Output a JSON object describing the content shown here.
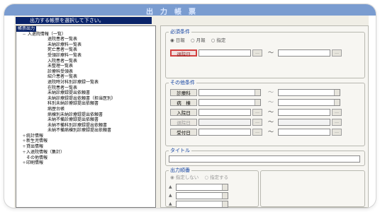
{
  "window": {
    "title": "出力帳票",
    "instruction": "出力する帳票を選択して下さい。"
  },
  "tree": {
    "root_label": "帳票出力",
    "group_main": "入退院情報（一覧）",
    "children": [
      "退院患者一覧表",
      "未納診療料一覧表",
      "死亡患者一覧表",
      "受領診療料一覧表",
      "入院患者一覧表",
      "未整理一覧表",
      "診療科受領表",
      "紹介患者一覧表",
      "退院時対科別診療録一覧表",
      "在院患者一覧表",
      "未納診療録提出依頼書",
      "未納診療録提出依頼書（担当医別）",
      "科別未納診療録提出依頼書",
      "病歴台帳",
      "病棟別未納診療録提出依頼書",
      "未納不備診療録提出依頼書",
      "未納不備科別診療録提出依頼書",
      "未納不備病棟別診療録提出依頼書"
    ],
    "other_groups": [
      "統計情報",
      "新生児情報",
      "貸出情報",
      "入退院情報（集計）",
      "その他情報",
      "印刷情報"
    ]
  },
  "required": {
    "title": "必須条件",
    "radios": [
      "日報",
      "月報",
      "指定"
    ],
    "field_label": "退院日",
    "range_sep": "〜"
  },
  "other": {
    "title": "その他条件",
    "rows": [
      "診療科",
      "病　棟",
      "入院日",
      "退院日",
      "受付日"
    ]
  },
  "title_section": {
    "title": "タイトル"
  },
  "order": {
    "title": "出力順番",
    "radios": [
      "指定しない",
      "指定する"
    ]
  },
  "colors": {
    "titlebar": "#7a9cd0",
    "selection": "#0a246a",
    "section_title": "#1040a0",
    "required_label": "#d24040"
  }
}
